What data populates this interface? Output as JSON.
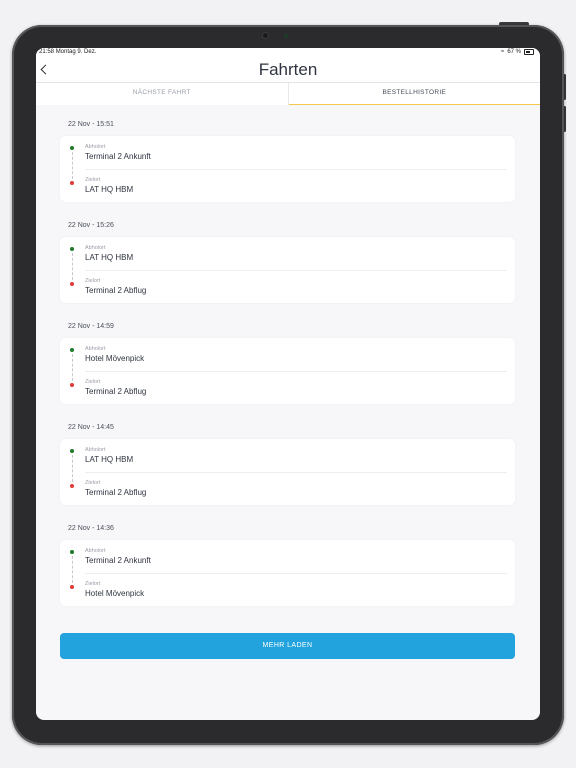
{
  "status": {
    "time": "21:58",
    "date": "Montag 9. Dez.",
    "battery": "67 %"
  },
  "header": {
    "title": "Fahrten"
  },
  "tabs": [
    {
      "label": "NÄCHSTE FAHRT",
      "active": false
    },
    {
      "label": "BESTELLHISTORIE",
      "active": true
    }
  ],
  "labels": {
    "pickup": "Abholort",
    "destination": "Zielort"
  },
  "trips": [
    {
      "datetime": "22 Nov - 15:51",
      "pickup": "Terminal 2 Ankunft",
      "destination": "LAT HQ HBM"
    },
    {
      "datetime": "22 Nov - 15:26",
      "pickup": "LAT HQ HBM",
      "destination": "Terminal 2 Abflug"
    },
    {
      "datetime": "22 Nov - 14:59",
      "pickup": "Hotel Mövenpick",
      "destination": "Terminal 2 Abflug"
    },
    {
      "datetime": "22 Nov - 14:45",
      "pickup": "LAT HQ HBM",
      "destination": "Terminal 2 Abflug"
    },
    {
      "datetime": "22 Nov - 14:36",
      "pickup": "Terminal 2 Ankunft",
      "destination": "Hotel Mövenpick"
    }
  ],
  "load_more": {
    "label": "MEHR LADEN"
  },
  "colors": {
    "accent": "#23a3dd",
    "tab_indicator": "#f2c94c",
    "pickup_dot": "#1f7a2a",
    "destination_dot": "#e33a3a"
  }
}
